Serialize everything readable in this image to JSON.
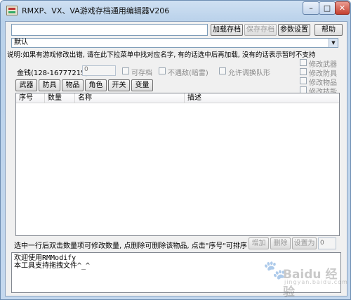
{
  "window": {
    "title": "RMXP、VX、VA游戏存档通用编辑器V206",
    "controls": {
      "minimize": "–",
      "maximize": "□",
      "close": "✕"
    }
  },
  "toolbar": {
    "path_value": "",
    "load_save": "加载存档",
    "save_save": "保存存档",
    "settings": "参数设置",
    "help": "帮助"
  },
  "profile": {
    "selected": "默认"
  },
  "instructions": "说明:如果有游戏修改出错, 请在此下拉菜单中找对应名字, 有的话选中后再加载, 没有的话表示暂时不支持",
  "gold": {
    "label": "金钱(128-16777215)",
    "value": "0"
  },
  "options": {
    "savable": "可存档",
    "no_encounter": "不遇敌(暗雷)",
    "allow_party": "允许调换队形"
  },
  "modify_options": {
    "weapon": "修改武器",
    "armor": "修改防具",
    "item": "修改物品",
    "skill": "修改技能"
  },
  "tabs": {
    "weapon": "武器",
    "armor": "防具",
    "item": "物品",
    "actor": "角色",
    "switch": "开关",
    "variable": "变量"
  },
  "table": {
    "columns": [
      "序号",
      "数量",
      "名称",
      "描述"
    ],
    "rows": []
  },
  "status_hint": "选中一行后双击数量项可修改数量, 点删除可删除该物品, 点击\"序号\"可排序",
  "actions": {
    "add": "增加",
    "delete": "删除",
    "set_to": "设置为",
    "set_value": "0"
  },
  "log": {
    "line1": "欢迎使用RMModify",
    "line2": "本工具支持拖拽文件^_^"
  },
  "watermark": {
    "text": "Baidu 经验",
    "sub": "jingyan.baidu.com"
  }
}
